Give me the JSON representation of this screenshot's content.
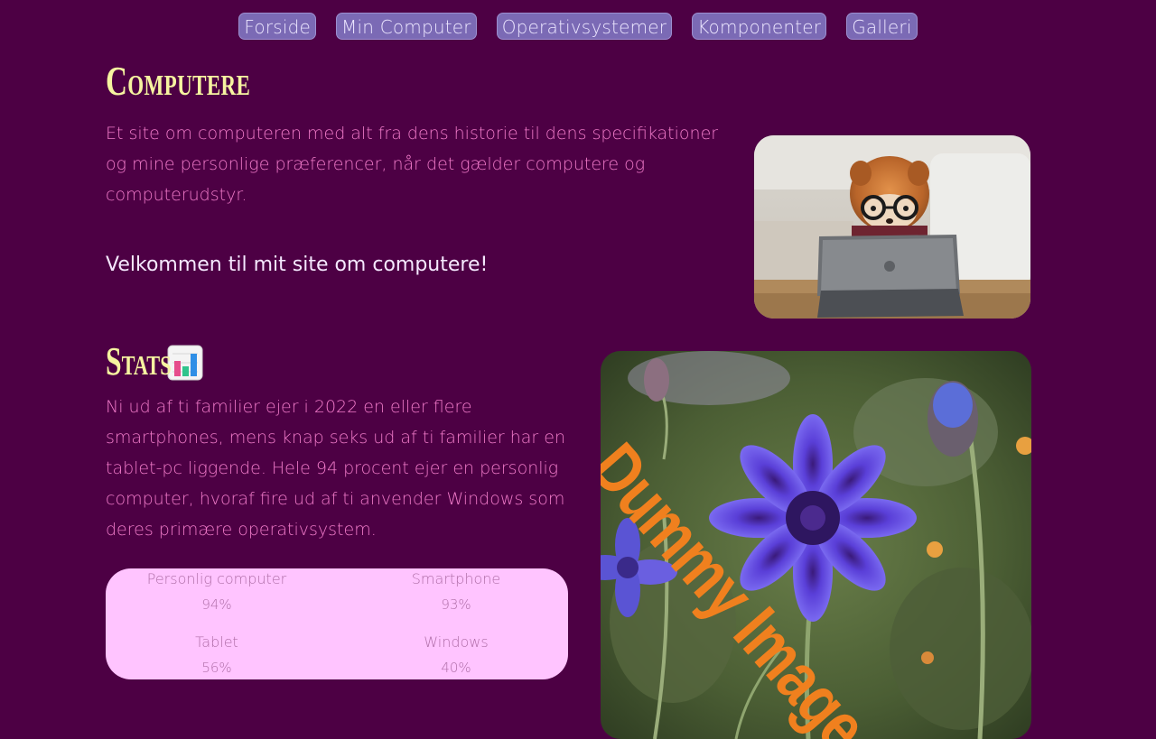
{
  "nav": {
    "items": [
      {
        "label": "Forside"
      },
      {
        "label": "Min Computer"
      },
      {
        "label": "Operativsystemer"
      },
      {
        "label": "Komponenter"
      },
      {
        "label": "Galleri"
      }
    ]
  },
  "hero": {
    "title": "Computere",
    "intro": "Et site om computeren med alt fra dens historie til dens specifikationer og mine personlige præferencer, når det gælder computere og computerudstyr.",
    "welcome": "Velkommen til mit site om computere!"
  },
  "stats": {
    "title": "Stats",
    "icon": "bar-chart-icon",
    "text": "Ni ud af ti familier ejer i 2022 en eller flere smartphones, mens knap seks ud af ti familier har en tablet-pc liggende. Hele 94 procent ejer en personlig computer, hvoraf fire ud af ti anvender Windows som deres primære operativsystem.",
    "items": [
      {
        "label": "Personlig computer",
        "value": "94%"
      },
      {
        "label": "Smartphone",
        "value": "93%"
      },
      {
        "label": "Tablet",
        "value": "56%"
      },
      {
        "label": "Windows",
        "value": "40%"
      }
    ]
  },
  "gallery": {
    "watermark": "Dummy Image"
  },
  "colors": {
    "background": "#4d0044",
    "nav_button": "#7b6ab5",
    "heading": "#f6f4a0",
    "body_text": "#f07ac9",
    "stats_box": "#ffc4ff",
    "watermark": "#f0801e"
  }
}
